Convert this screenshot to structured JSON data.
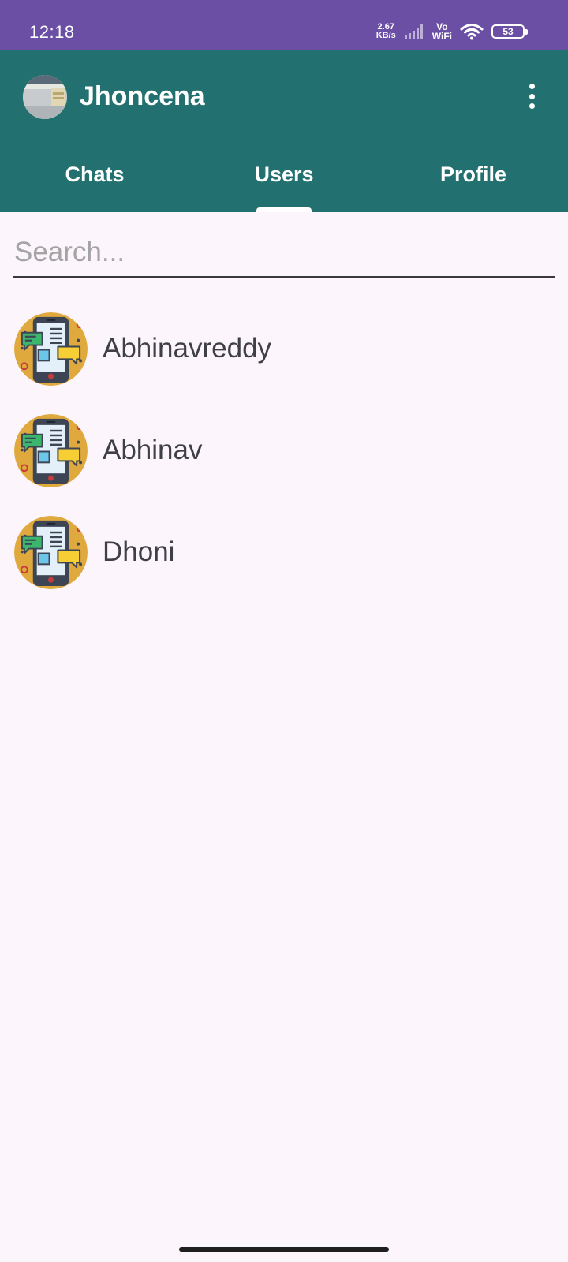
{
  "status_bar": {
    "time": "12:18",
    "net_speed_value": "2.67",
    "net_speed_unit": "KB/s",
    "volte_top": "Vo",
    "volte_bottom": "WiFi",
    "battery": "53",
    "bg_color": "#6a4fa4"
  },
  "app_bar": {
    "title": "Jhoncena",
    "bg_color": "#22706f"
  },
  "tabs": [
    {
      "label": "Chats",
      "selected": false
    },
    {
      "label": "Users",
      "selected": true
    },
    {
      "label": "Profile",
      "selected": false
    }
  ],
  "search": {
    "placeholder": "Search...",
    "value": ""
  },
  "users": [
    {
      "name": "Abhinavreddy"
    },
    {
      "name": "Abhinav"
    },
    {
      "name": "Dhoni"
    }
  ]
}
